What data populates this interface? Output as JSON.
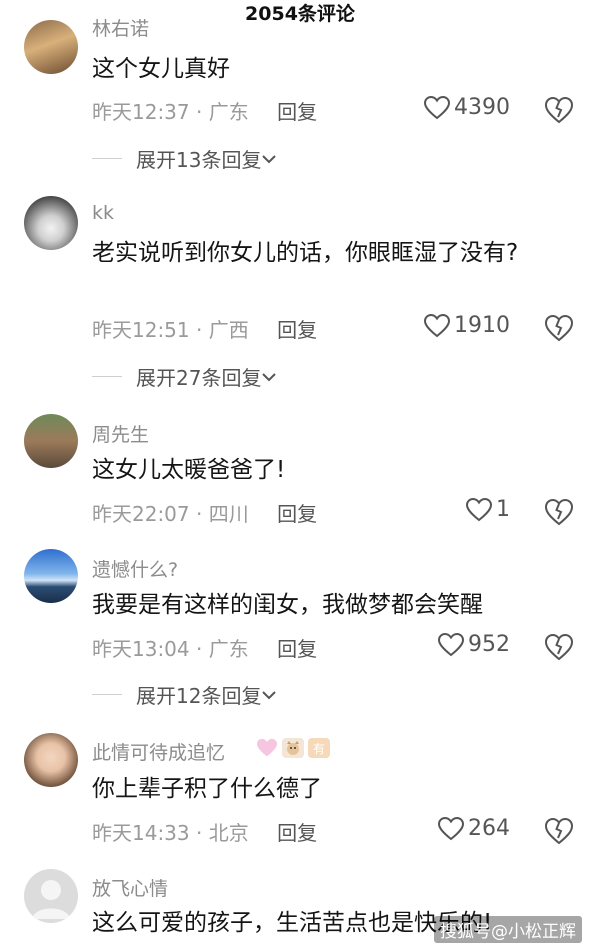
{
  "header": {
    "title": "2054条评论"
  },
  "comments": [
    {
      "username": "林右诺",
      "text": "这个女儿真好",
      "time": "昨天12:37",
      "location": "广东",
      "reply_label": "回复",
      "likes": "4390",
      "expand": "展开13条回复"
    },
    {
      "username": "kk",
      "text": "老实说听到你女儿的话，你眼眶湿了没有?",
      "time": "昨天12:51",
      "location": "广西",
      "reply_label": "回复",
      "likes": "1910",
      "expand": "展开27条回复"
    },
    {
      "username": "周先生",
      "text": "这女儿太暖爸爸了!",
      "time": "昨天22:07",
      "location": "四川",
      "reply_label": "回复",
      "likes": "1",
      "expand": ""
    },
    {
      "username": "遗憾什么?",
      "text": "我要是有这样的闺女，我做梦都会笑醒",
      "time": "昨天13:04",
      "location": "广东",
      "reply_label": "回复",
      "likes": "952",
      "expand": "展开12条回复"
    },
    {
      "username": "此情可待成追忆",
      "text": "你上辈子积了什么德了",
      "time": "昨天14:33",
      "location": "北京",
      "reply_label": "回复",
      "likes": "264",
      "expand": "",
      "badge_text": "有"
    },
    {
      "username": "放飞心情",
      "text": "这么可爱的孩子，生活苦点也是快乐的!",
      "time": "",
      "location": "",
      "reply_label": "",
      "likes": "",
      "expand": ""
    }
  ],
  "meta_separator": "·",
  "watermark": "搜狐号@小松正辉",
  "colors": {
    "username": "#8c8c8c",
    "meta": "#9a9a9a",
    "badge_heart": "#f6c6e0",
    "badge_text_bg": "#f5d9b8"
  }
}
